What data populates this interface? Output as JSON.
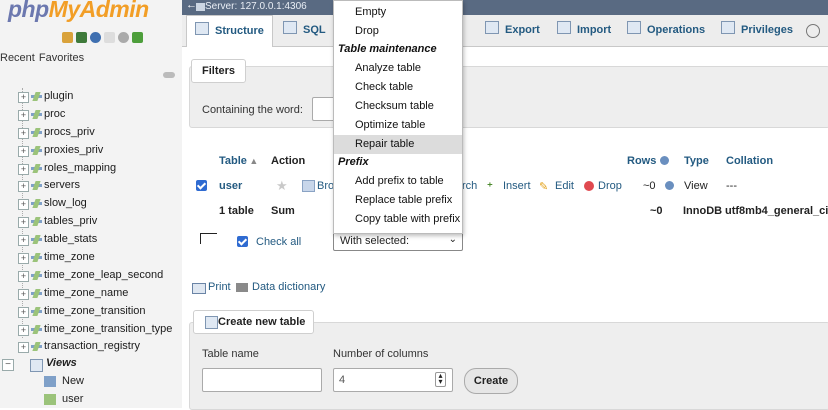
{
  "logo": {
    "php": "php",
    "my": "MyAdmin"
  },
  "left": {
    "tabs": [
      "Recent",
      "Favorites"
    ],
    "tree_items": [
      "plugin",
      "proc",
      "procs_priv",
      "proxies_priv",
      "roles_mapping",
      "servers",
      "slow_log",
      "tables_priv",
      "table_stats",
      "time_zone",
      "time_zone_leap_second",
      "time_zone_name",
      "time_zone_transition",
      "time_zone_transition_type",
      "transaction_registry"
    ],
    "views_label": "Views",
    "views_new": "New",
    "views_user": "user"
  },
  "topbar": {
    "server": "Server: 127.0.0.1:4306"
  },
  "tabs": {
    "structure": "Structure",
    "sql": "SQL",
    "export": "Export",
    "import": "Import",
    "operations": "Operations",
    "privileges": "Privileges"
  },
  "filters": {
    "legend": "Filters",
    "label": "Containing the word:",
    "value": ""
  },
  "table": {
    "headers": {
      "table": "Table",
      "action": "Action",
      "rows": "Rows",
      "type": "Type",
      "collation": "Collation"
    },
    "row": {
      "name": "user",
      "browse": "Bro",
      "search": "rch",
      "insert": "Insert",
      "empty": "Edit",
      "drop": "Drop",
      "rows": "~0",
      "type": "View",
      "collation": "---"
    },
    "sum": {
      "count": "1 table",
      "label": "Sum",
      "rows": "~0",
      "type": "InnoDB",
      "collation": "utf8mb4_general_ci"
    }
  },
  "check_all": "Check all",
  "with_selected": "With selected:",
  "dropdown": {
    "items_top": [
      "Empty",
      "Drop"
    ],
    "group1": "Table maintenance",
    "maintenance": [
      "Analyze table",
      "Check table",
      "Checksum table",
      "Optimize table",
      "Repair table"
    ],
    "group2": "Prefix",
    "prefix": [
      "Add prefix to table",
      "Replace table prefix",
      "Copy table with prefix"
    ],
    "highlighted": "Repair table"
  },
  "print_label": "Print",
  "dict_label": "Data dictionary",
  "create": {
    "legend": "Create new table",
    "name_label": "Table name",
    "cols_label": "Number of columns",
    "cols_value": "4",
    "button": "Create"
  }
}
